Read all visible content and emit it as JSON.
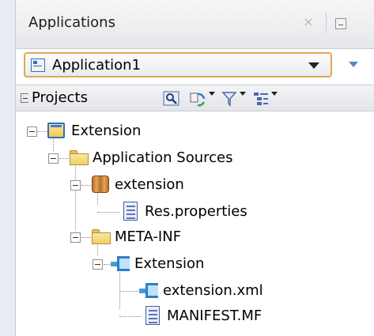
{
  "header": {
    "title": "Applications",
    "close_glyph": "×"
  },
  "app_selector": {
    "value": "Application1"
  },
  "projects_bar": {
    "label": "Projects",
    "icons": [
      "find-icon",
      "sync-icon",
      "filter-icon",
      "options-icon"
    ]
  },
  "tree": {
    "project": "Extension",
    "app_sources": "Application Sources",
    "package": "extension",
    "res_file": "Res.properties",
    "meta_folder": "META-INF",
    "ext_node": "Extension",
    "ext_xml": "extension.xml",
    "manifest": "MANIFEST.MF"
  },
  "colors": {
    "combo_border": "#e3a94b",
    "accent_blue": "#2f6fbe",
    "folder_yellow": "#efcf63"
  }
}
